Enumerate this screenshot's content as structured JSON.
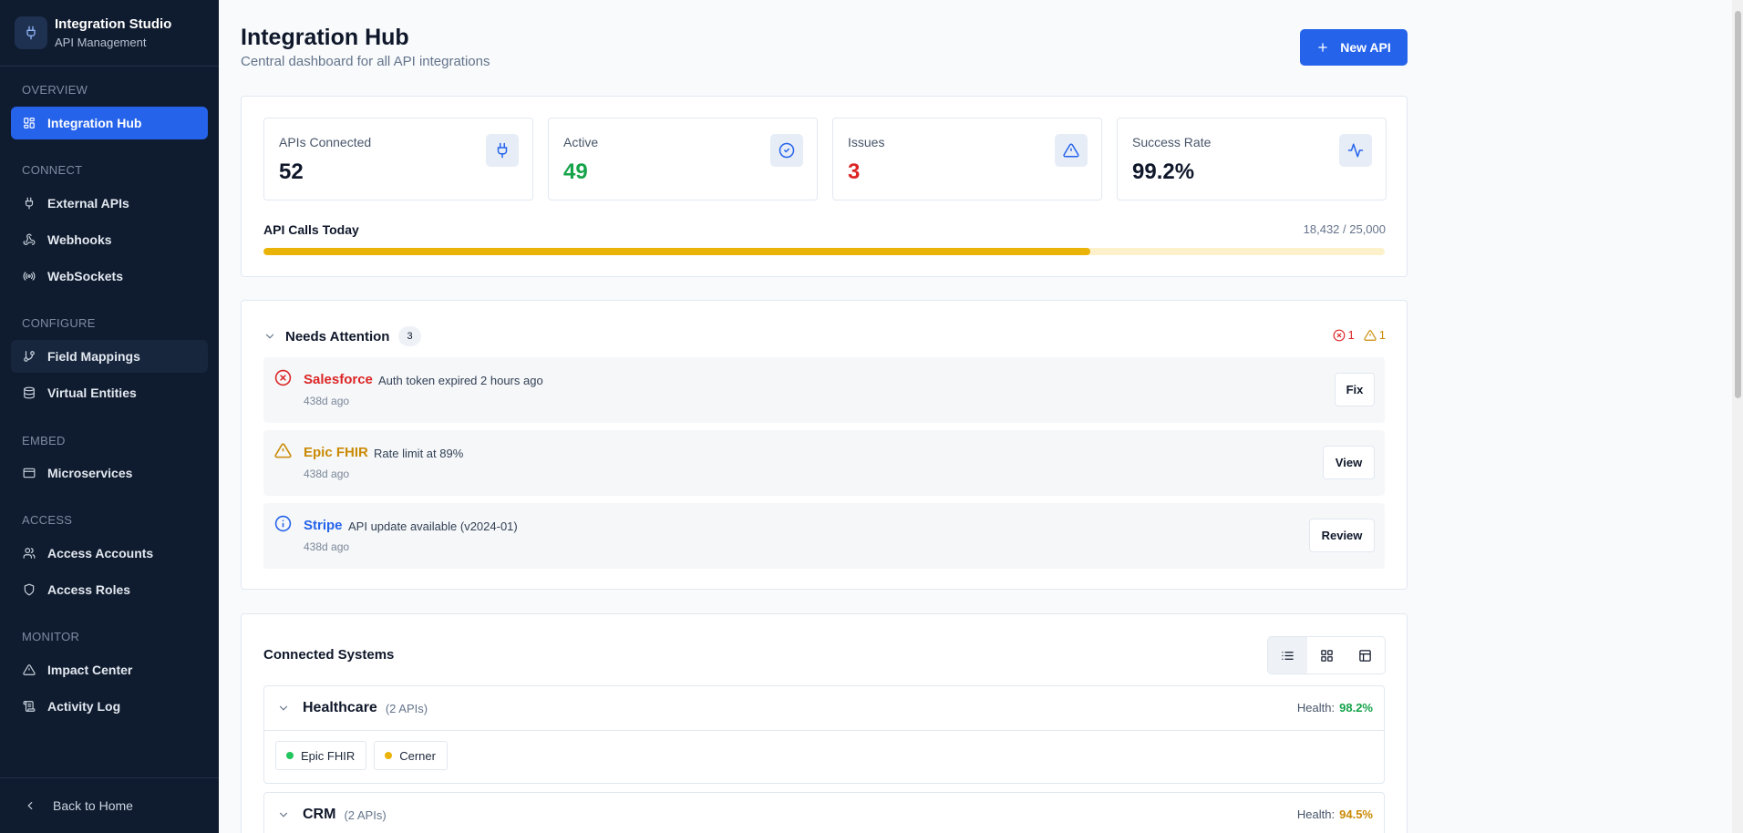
{
  "sidebar": {
    "brand_title": "Integration Studio",
    "brand_subtitle": "API Management",
    "sections": {
      "overview": "OVERVIEW",
      "connect": "CONNECT",
      "configure": "CONFIGURE",
      "embed": "EMBED",
      "access": "ACCESS",
      "monitor": "MONITOR"
    },
    "items": {
      "integration_hub": "Integration Hub",
      "external_apis": "External APIs",
      "webhooks": "Webhooks",
      "websockets": "WebSockets",
      "field_mappings": "Field Mappings",
      "virtual_entities": "Virtual Entities",
      "microservices": "Microservices",
      "access_accounts": "Access Accounts",
      "access_roles": "Access Roles",
      "impact_center": "Impact Center",
      "activity_log": "Activity Log"
    },
    "active_item": "Integration Hub",
    "back_label": "Back to Home"
  },
  "header": {
    "title": "Integration Hub",
    "subtitle": "Central dashboard for all API integrations",
    "new_api_label": "New API"
  },
  "stats": [
    {
      "label": "APIs Connected",
      "value": "52",
      "icon": "plug-icon"
    },
    {
      "label": "Active",
      "value": "49",
      "icon": "check-circle-icon"
    },
    {
      "label": "Issues",
      "value": "3",
      "icon": "alert-triangle-icon"
    },
    {
      "label": "Success Rate",
      "value": "99.2%",
      "icon": "activity-icon"
    }
  ],
  "api_calls": {
    "label": "API Calls Today",
    "value_text": "18,432 / 25,000",
    "used": 18432,
    "limit": 25000
  },
  "attention": {
    "title": "Needs Attention",
    "count": "3",
    "error_count": "1",
    "warning_count": "1",
    "alerts": [
      {
        "name": "Salesforce",
        "message": "Auth token expired 2 hours ago",
        "time": "438d ago",
        "action": "Fix",
        "level": "error"
      },
      {
        "name": "Epic FHIR",
        "message": "Rate limit at 89%",
        "time": "438d ago",
        "action": "View",
        "level": "warning"
      },
      {
        "name": "Stripe",
        "message": "API update available (v2024-01)",
        "time": "438d ago",
        "action": "Review",
        "level": "info"
      }
    ]
  },
  "connected": {
    "title": "Connected Systems",
    "view_modes": [
      "list-icon",
      "grid-icon",
      "table-icon"
    ],
    "active_view": "list-icon",
    "health_label": "Health:",
    "groups": [
      {
        "name": "Healthcare",
        "count": "(2 APIs)",
        "health": "98.2%",
        "apis": [
          {
            "name": "Epic FHIR",
            "status": "active"
          },
          {
            "name": "Cerner",
            "status": "warning"
          }
        ]
      },
      {
        "name": "CRM",
        "count": "(2 APIs)",
        "health": "94.5%"
      }
    ]
  },
  "colors": {
    "accent": "#2563eb",
    "sidebar_bg": "#0f1b2e",
    "success": "#16a34a",
    "error": "#dc2626",
    "warning": "#ca8a04",
    "info": "#2563eb",
    "progress": "#eab308"
  }
}
